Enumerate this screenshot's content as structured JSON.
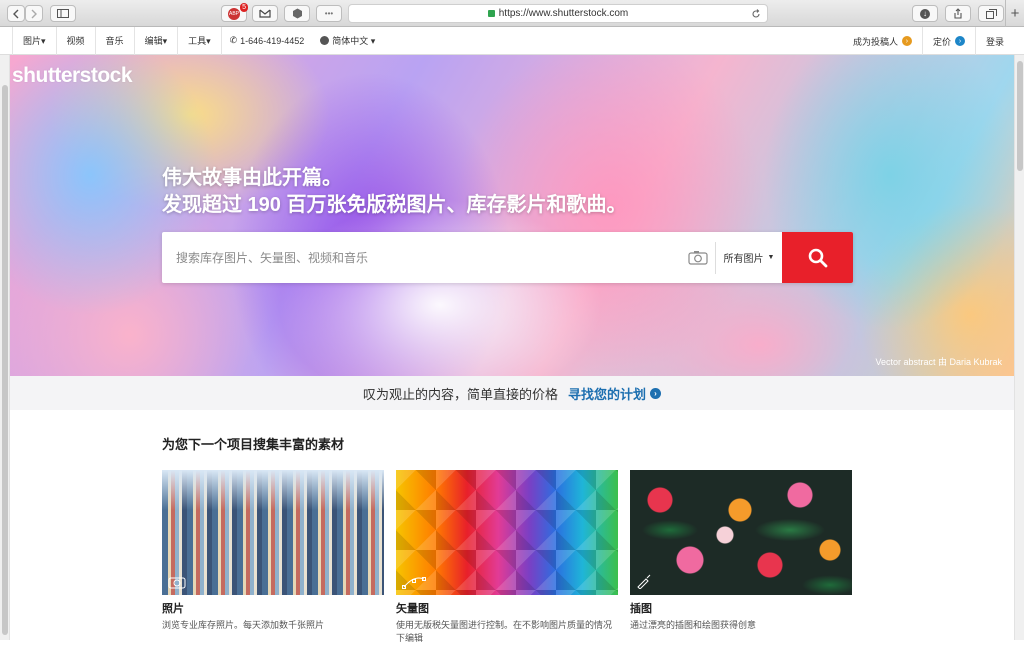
{
  "browser": {
    "url": "https://www.shutterstock.com",
    "extension_badge": "5",
    "new_tab_symbol": "+"
  },
  "nav": {
    "left": [
      {
        "label": "图片▾"
      },
      {
        "label": "视频"
      },
      {
        "label": "音乐"
      },
      {
        "label": "编辑▾"
      },
      {
        "label": "工具▾"
      }
    ],
    "phone": "1-646-419-4452",
    "language": "简体中文 ▾",
    "contributor": "成为投稿人",
    "pricing": "定价",
    "login": "登录",
    "colors": {
      "contributor_badge": "#e69a1f",
      "pricing_badge": "#1d86c8"
    }
  },
  "hero": {
    "logo": "shutterstock",
    "headline_line1": "伟大故事由此开篇。",
    "headline_line2": "发现超过 190 百万张免版税图片、库存影片和歌曲。",
    "search_placeholder": "搜索库存图片、矢量图、视频和音乐",
    "filter_label": "所有图片",
    "credit": "Vector abstract 由 Daria Kubrak",
    "colors": {
      "search_button": "#e8202a"
    }
  },
  "banner": {
    "text": "叹为观止的内容，简单直接的价格",
    "cta": "寻找您的计划"
  },
  "section": {
    "title": "为您下一个项目搜集丰富的素材"
  },
  "cards": [
    {
      "title": "照片",
      "description": "浏览专业库存照片。每天添加数千张照片"
    },
    {
      "title": "矢量图",
      "description": "使用无版税矢量图进行控制。在不影响图片质量的情况下编辑"
    },
    {
      "title": "插图",
      "description": "通过漂亮的插图和绘图获得创意"
    }
  ]
}
